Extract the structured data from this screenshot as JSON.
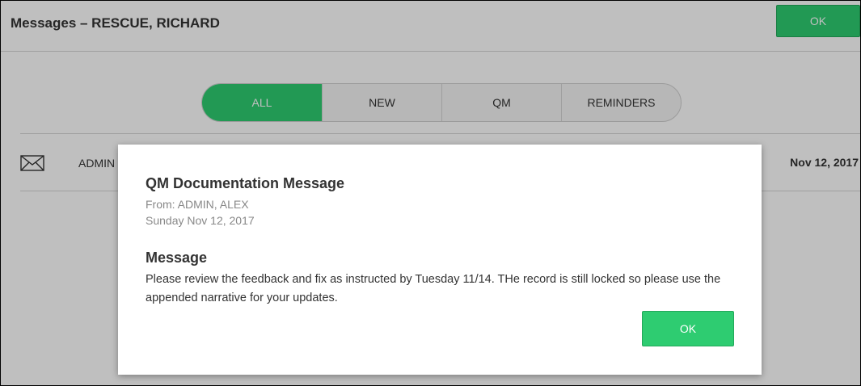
{
  "header": {
    "title": "Messages – RESCUE, RICHARD",
    "ok_label": "OK"
  },
  "tabs": [
    {
      "label": "ALL",
      "active": true
    },
    {
      "label": "NEW",
      "active": false
    },
    {
      "label": "QM",
      "active": false
    },
    {
      "label": "REMINDERS",
      "active": false
    }
  ],
  "messages": [
    {
      "icon": "envelope-icon",
      "sender": "ADMIN",
      "date": "Nov 12, 2017"
    }
  ],
  "modal": {
    "title": "QM Documentation Message",
    "from": "From: ADMIN, ALEX",
    "date": "Sunday Nov 12, 2017",
    "message_label": "Message",
    "message_body": "Please review the feedback and fix as instructed by Tuesday 11/14.  THe record is still locked so please use the appended narrative for your updates.",
    "ok_label": "OK"
  },
  "colors": {
    "accent": "#2ecc71",
    "accent_border": "#23a85a",
    "overlay": "rgba(0,0,0,0.25)"
  }
}
